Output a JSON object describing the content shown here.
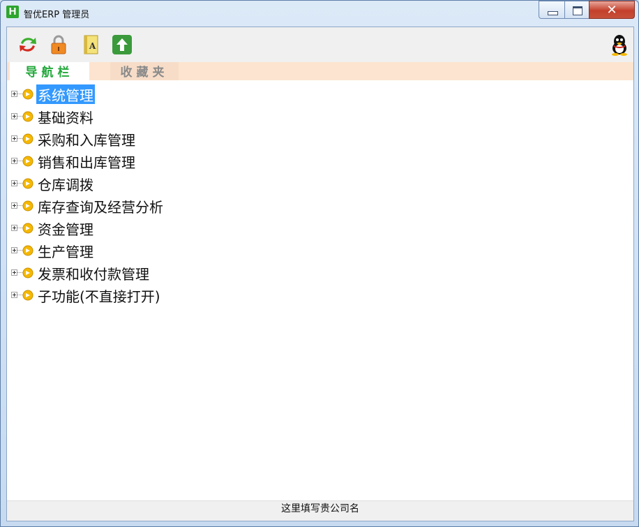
{
  "window": {
    "app_icon_letter": "H",
    "title": "智优ERP 管理员",
    "close_glyph": "✕"
  },
  "toolbar": {
    "buttons": [
      {
        "name": "refresh-icon"
      },
      {
        "name": "lock-icon"
      },
      {
        "name": "book-icon",
        "letter": "A"
      },
      {
        "name": "upload-icon"
      }
    ],
    "right_icon": "qq-penguin-icon"
  },
  "tabs": {
    "nav": "导航栏",
    "favorites": "收藏夹"
  },
  "tree": {
    "items": [
      {
        "label": "系统管理",
        "selected": true
      },
      {
        "label": "基础资料"
      },
      {
        "label": "采购和入库管理"
      },
      {
        "label": "销售和出库管理"
      },
      {
        "label": "仓库调拨"
      },
      {
        "label": "库存查询及经营分析"
      },
      {
        "label": "资金管理"
      },
      {
        "label": "生产管理"
      },
      {
        "label": "发票和收付款管理"
      },
      {
        "label": "子功能(不直接打开)"
      }
    ]
  },
  "status": {
    "company": "这里填写贵公司名"
  },
  "colors": {
    "selection": "#3399ff",
    "tab_active": "#22a83a",
    "tab_bar": "#fde4d0",
    "node_icon": "#f5b800"
  }
}
